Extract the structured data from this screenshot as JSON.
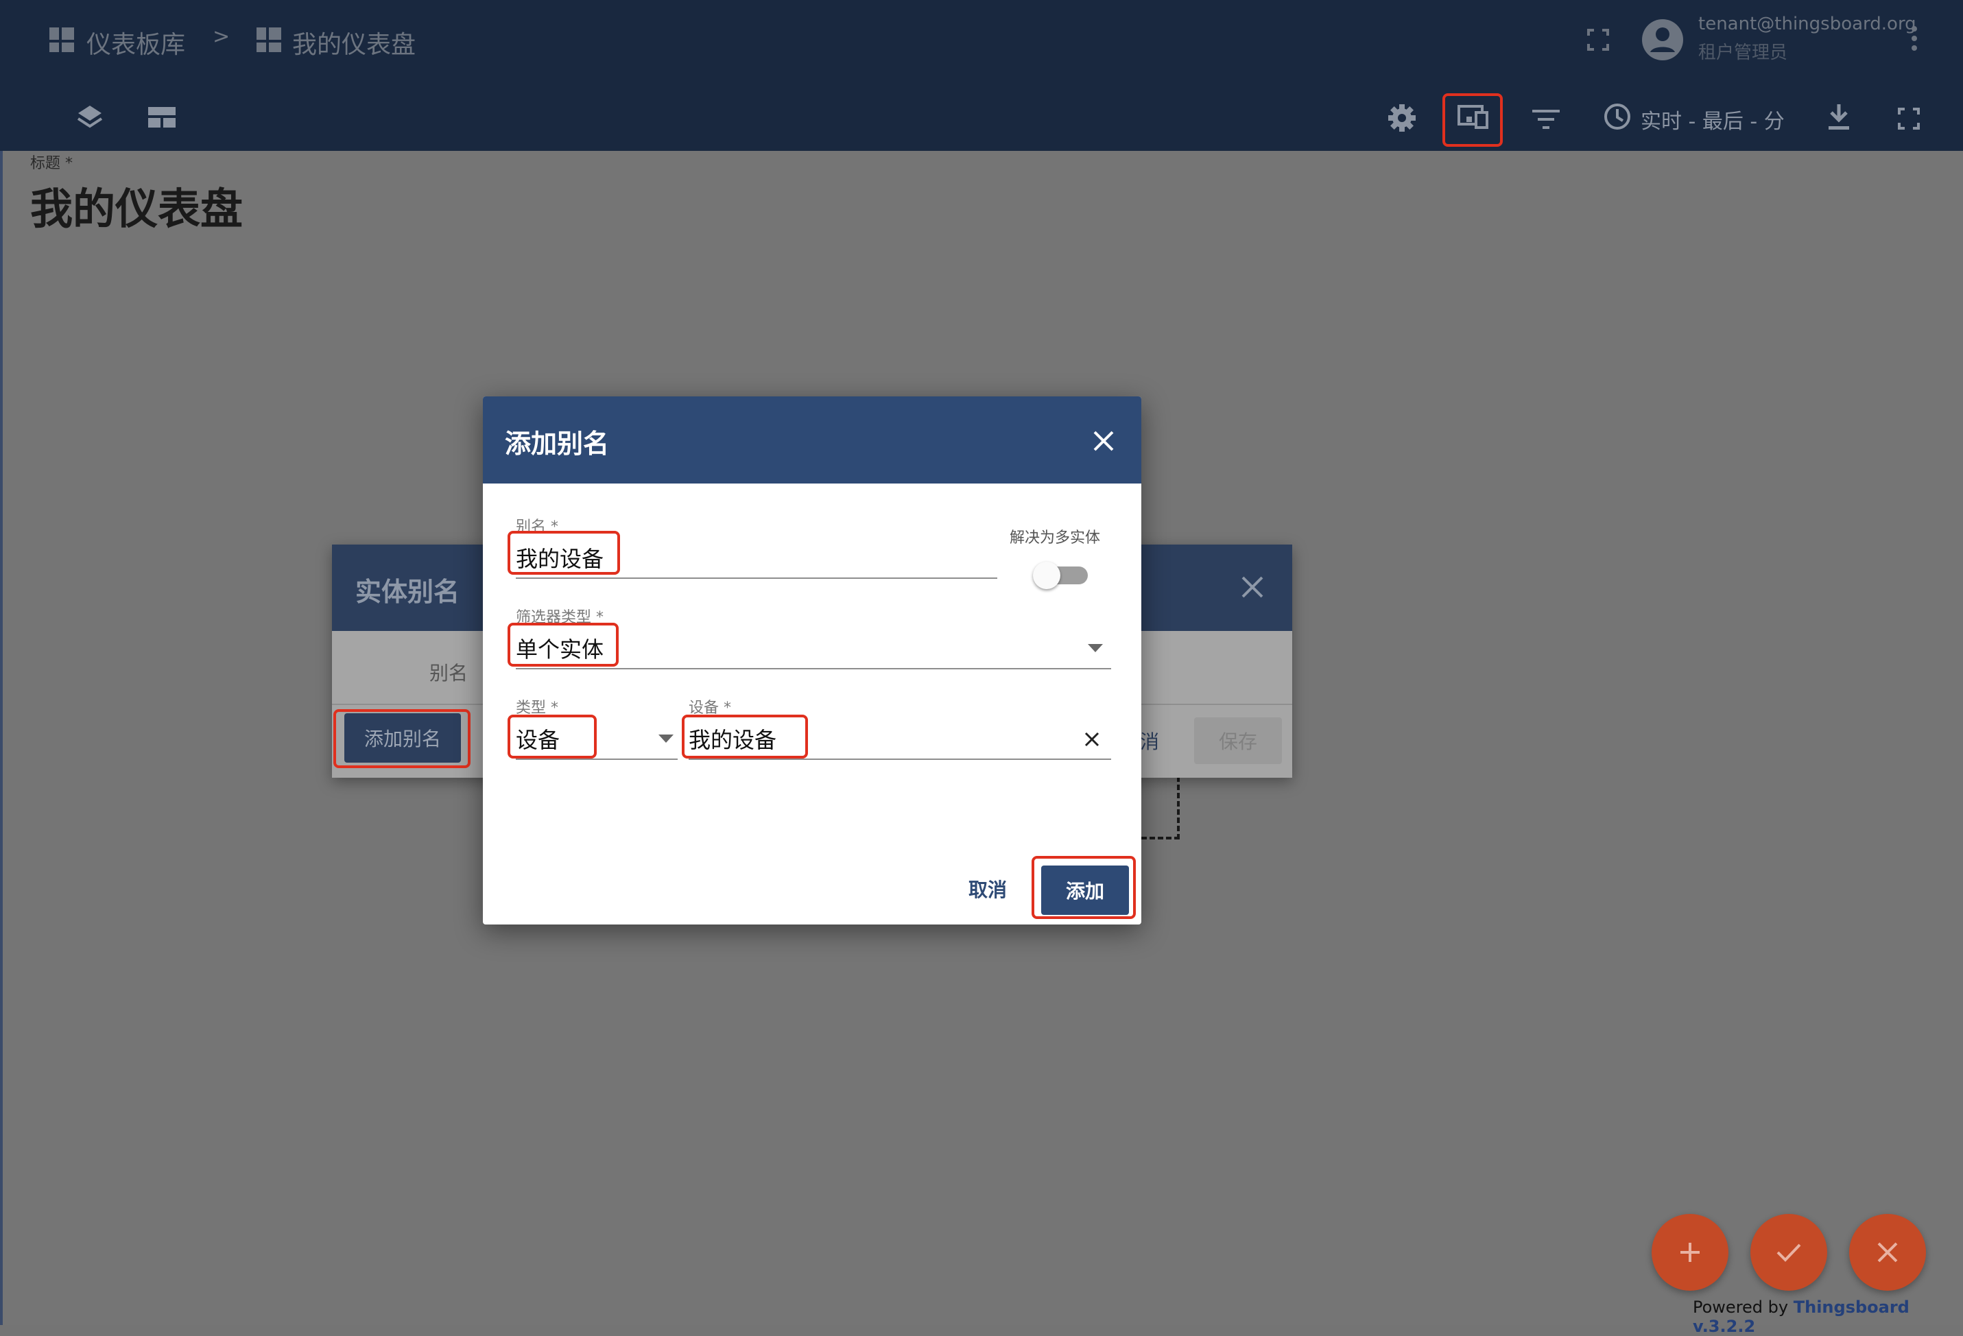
{
  "header": {
    "breadcrumb": [
      "仪表板库",
      "我的仪表盘"
    ],
    "breadcrumb_separator": ">",
    "user_email": "tenant@thingsboard.org",
    "user_role": "租户管理员"
  },
  "toolbar": {
    "timewindow_label": "实时 - 最后 - 分"
  },
  "dashboard": {
    "title_label": "标题 *",
    "title_value": "我的仪表盘"
  },
  "entity_aliases_dialog": {
    "title": "实体别名",
    "column_alias": "别名",
    "add_alias_button": "添加别名",
    "cancel_partial": "消",
    "save_button": "保存"
  },
  "add_alias_dialog": {
    "title": "添加别名",
    "alias_label": "别名 *",
    "alias_value": "我的设备",
    "resolve_multiple_label": "解决为多实体",
    "filter_type_label": "筛选器类型 *",
    "filter_type_value": "单个实体",
    "type_label": "类型 *",
    "type_value": "设备",
    "device_label": "设备 *",
    "device_value": "我的设备",
    "cancel_button": "取消",
    "add_button": "添加"
  },
  "footer": {
    "powered_by": "Powered by",
    "brand": "Thingsboard v.3.2.2"
  },
  "colors": {
    "header_bg": "#19283f",
    "dialog_header": "#2e4a75",
    "primary_button": "#2e4a75",
    "highlight": "#e0301e",
    "fab": "#c44a26"
  }
}
